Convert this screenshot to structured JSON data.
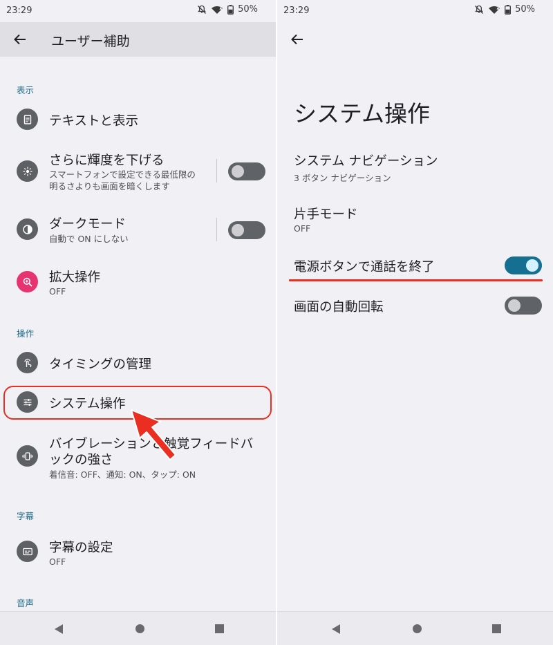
{
  "status": {
    "time": "23:29",
    "battery": "50%"
  },
  "left": {
    "title": "ユーザー補助",
    "sections": {
      "display": "表示",
      "interaction": "操作",
      "captions": "字幕",
      "audio": "音声"
    },
    "items": {
      "text_display": {
        "title": "テキストと表示",
        "icon": "text-document-icon"
      },
      "extra_dim": {
        "title": "さらに輝度を下げる",
        "subtitle_line1": "スマートフォンで設定できる最低限の",
        "subtitle_line2": "明るさよりも画面を暗くします",
        "icon": "brightness-icon",
        "toggle_on": false
      },
      "dark_mode": {
        "title": "ダークモード",
        "subtitle": "自動で ON にしない",
        "icon": "contrast-icon",
        "toggle_on": false
      },
      "magnification": {
        "title": "拡大操作",
        "subtitle": "OFF",
        "icon": "magnify-icon"
      },
      "timing": {
        "title": "タイミングの管理",
        "icon": "touch-timer-icon"
      },
      "system_controls": {
        "title": "システム操作",
        "icon": "sliders-icon"
      },
      "vibration": {
        "title_line1": "バイブレーションと触覚フィードバ",
        "title_line2": "ックの強さ",
        "subtitle": "着信音: OFF、通知: ON、タップ: ON",
        "icon": "vibration-icon"
      },
      "caption_settings": {
        "title": "字幕の設定",
        "subtitle": "OFF",
        "icon": "captions-icon"
      }
    }
  },
  "right": {
    "title": "システム操作",
    "items": {
      "navigation": {
        "title": "システム ナビゲーション",
        "subtitle": "3 ボタン ナビゲーション"
      },
      "one_handed": {
        "title": "片手モード",
        "subtitle": "OFF"
      },
      "power_ends_call": {
        "title": "電源ボタンで通話を終了",
        "toggle_on": true
      },
      "auto_rotate": {
        "title": "画面の自動回転",
        "toggle_on": false
      }
    }
  },
  "colors": {
    "accent": "#146f91",
    "annotation": "#ea2e21",
    "section_header": "#1d6b89"
  }
}
